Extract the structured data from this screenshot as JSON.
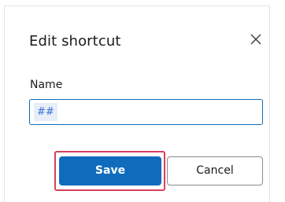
{
  "dialog": {
    "title": "Edit shortcut",
    "close_icon": "close-icon",
    "name_label": "Name",
    "name_value": "##",
    "save_label": "Save",
    "cancel_label": "Cancel"
  },
  "colors": {
    "accent": "#0f6cbd",
    "highlight_border": "#d6415d",
    "text": "#1b1b1b"
  }
}
